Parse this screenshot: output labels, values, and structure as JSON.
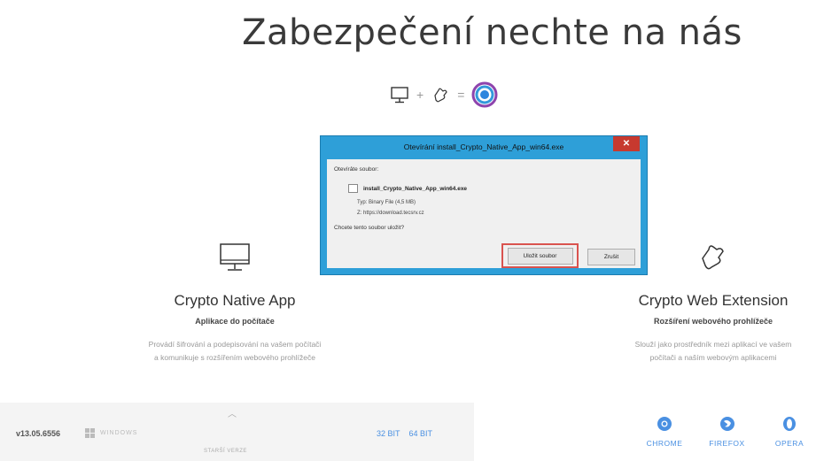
{
  "page": {
    "title": "Zabezpečení nechte na nás"
  },
  "equation": {
    "plus": "+",
    "equals": "="
  },
  "native_app": {
    "title": "Crypto Native App",
    "subtitle": "Aplikace do počítače",
    "description": "Provádí šifrování a podepisování na vašem počítači a komunikuje s rozšířením webového prohlížeče"
  },
  "download_strip": {
    "version": "v13.05.6556",
    "os_label": "WINDOWS",
    "bit32": "32 BIT",
    "bit64": "64 BIT",
    "older": "STARŠÍ VERZE"
  },
  "web_extension": {
    "title": "Crypto Web Extension",
    "subtitle": "Rozšíření webového prohlížeče",
    "description": "Slouží jako prostředník mezi aplikací ve vašem počítači a naším webovým aplikacemi"
  },
  "browsers": [
    {
      "label": "CHROME"
    },
    {
      "label": "FIREFOX"
    },
    {
      "label": "OPERA"
    }
  ],
  "dialog": {
    "title": "Otevírání install_Crypto_Native_App_win64.exe",
    "close": "✕",
    "prompt": "Otevírá̇te soubor:",
    "filename": "install_Crypto_Native_App_win64.exe",
    "type_line": "Typ: Binary File (4,5 MB)",
    "from_line": "Z: https://download.tecsrv.cz",
    "question": "Chcete tento soubor uložit?",
    "save": "Uložit soubor",
    "cancel": "Zrušit"
  },
  "colors": {
    "dialog_frame": "#2e9fd8",
    "close_red": "#c7392f",
    "link_blue": "#4a90e2",
    "highlight": "#d9534f"
  }
}
